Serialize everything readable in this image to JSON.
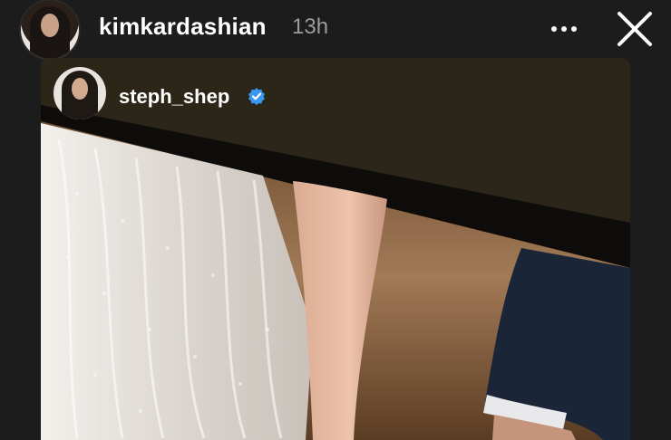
{
  "story": {
    "username": "kimkardashian",
    "time": "13h",
    "menu_icon": "more-horizontal-icon",
    "close_icon": "close-icon"
  },
  "reshared_post": {
    "username": "steph_shep",
    "verified": true,
    "verified_icon": "verified-badge-icon",
    "badge_color": "#3897f0"
  },
  "colors": {
    "background": "#1c1c1c",
    "text": "#ffffff",
    "muted": "#9c9c9c"
  }
}
